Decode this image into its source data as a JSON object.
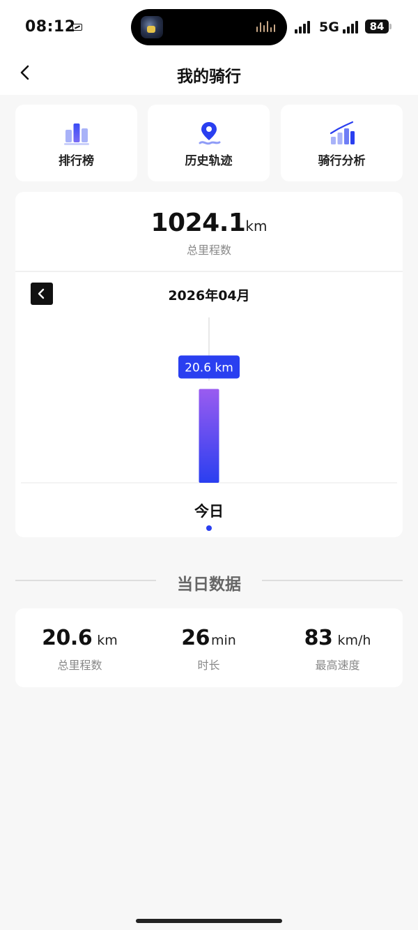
{
  "status_bar": {
    "time": "08:12",
    "network": "5G",
    "battery": "84"
  },
  "nav": {
    "title": "我的骑行",
    "back_icon": "chevron-left-icon"
  },
  "features": [
    {
      "label": "排行榜",
      "icon": "leaderboard-icon"
    },
    {
      "label": "历史轨迹",
      "icon": "route-pin-icon"
    },
    {
      "label": "骑行分析",
      "icon": "trend-chart-icon"
    }
  ],
  "summary": {
    "total_distance": "1024.1",
    "total_unit": "km",
    "total_label": "总里程数",
    "month": "2026年04月"
  },
  "chart_data": {
    "type": "bar",
    "categories": [
      "今日"
    ],
    "values": [
      20.6
    ],
    "unit": "km",
    "tooltip": "20.6 km",
    "ylim": [
      0,
      25
    ],
    "grid": false,
    "bar_gradient": [
      "#9a5cf0",
      "#2a3ff0"
    ]
  },
  "daily": {
    "heading": "当日数据",
    "stats": [
      {
        "value": "20.6",
        "unit": "km",
        "label": "总里程数"
      },
      {
        "value": "26",
        "unit": "min",
        "label": "时长"
      },
      {
        "value": "83",
        "unit": "km/h",
        "label": "最高速度"
      }
    ]
  },
  "colors": {
    "accent": "#2a3ff0",
    "accent_purple": "#9a5cf0",
    "background": "#f7f7f7",
    "card": "#ffffff"
  }
}
